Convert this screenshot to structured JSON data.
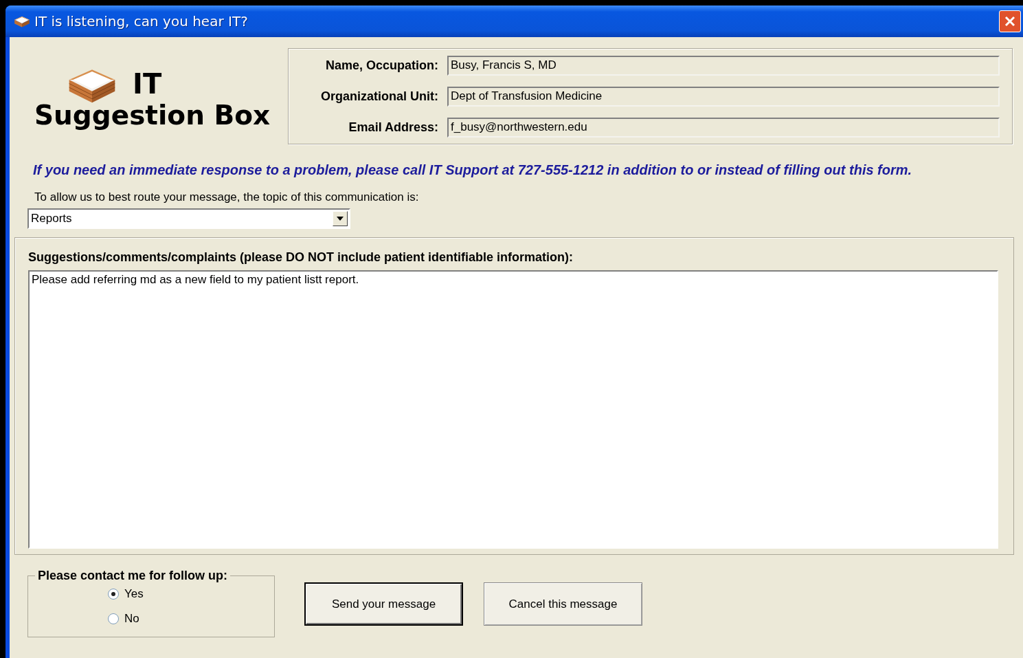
{
  "window": {
    "title": "IT is listening, can you hear IT?"
  },
  "logo": {
    "line_1": "IT",
    "line_2": "Suggestion Box"
  },
  "info_fields": [
    {
      "label": "Name, Occupation:",
      "value": "Busy, Francis S, MD"
    },
    {
      "label": "Organizational Unit:",
      "value": "Dept of Transfusion Medicine"
    },
    {
      "label": "Email Address:",
      "value": "f_busy@northwestern.edu"
    }
  ],
  "notice": "If you need an immediate response to a problem, please call IT Support at 727-555-1212 in addition to or instead of filling out this form.",
  "topic": {
    "label": "To allow us to best route your message, the topic of this communication is:",
    "value": "Reports"
  },
  "suggestions": {
    "label": "Suggestions/comments/complaints (please DO NOT include patient identifiable information):",
    "value": "Please add referring md as a new field to my patient listt report."
  },
  "follow_up": {
    "title": "Please contact me for follow up:",
    "options": [
      {
        "label": "Yes",
        "selected": true
      },
      {
        "label": "No",
        "selected": false
      }
    ]
  },
  "buttons": [
    {
      "label": "Send your message",
      "default": true
    },
    {
      "label": "Cancel this message",
      "default": false
    }
  ]
}
